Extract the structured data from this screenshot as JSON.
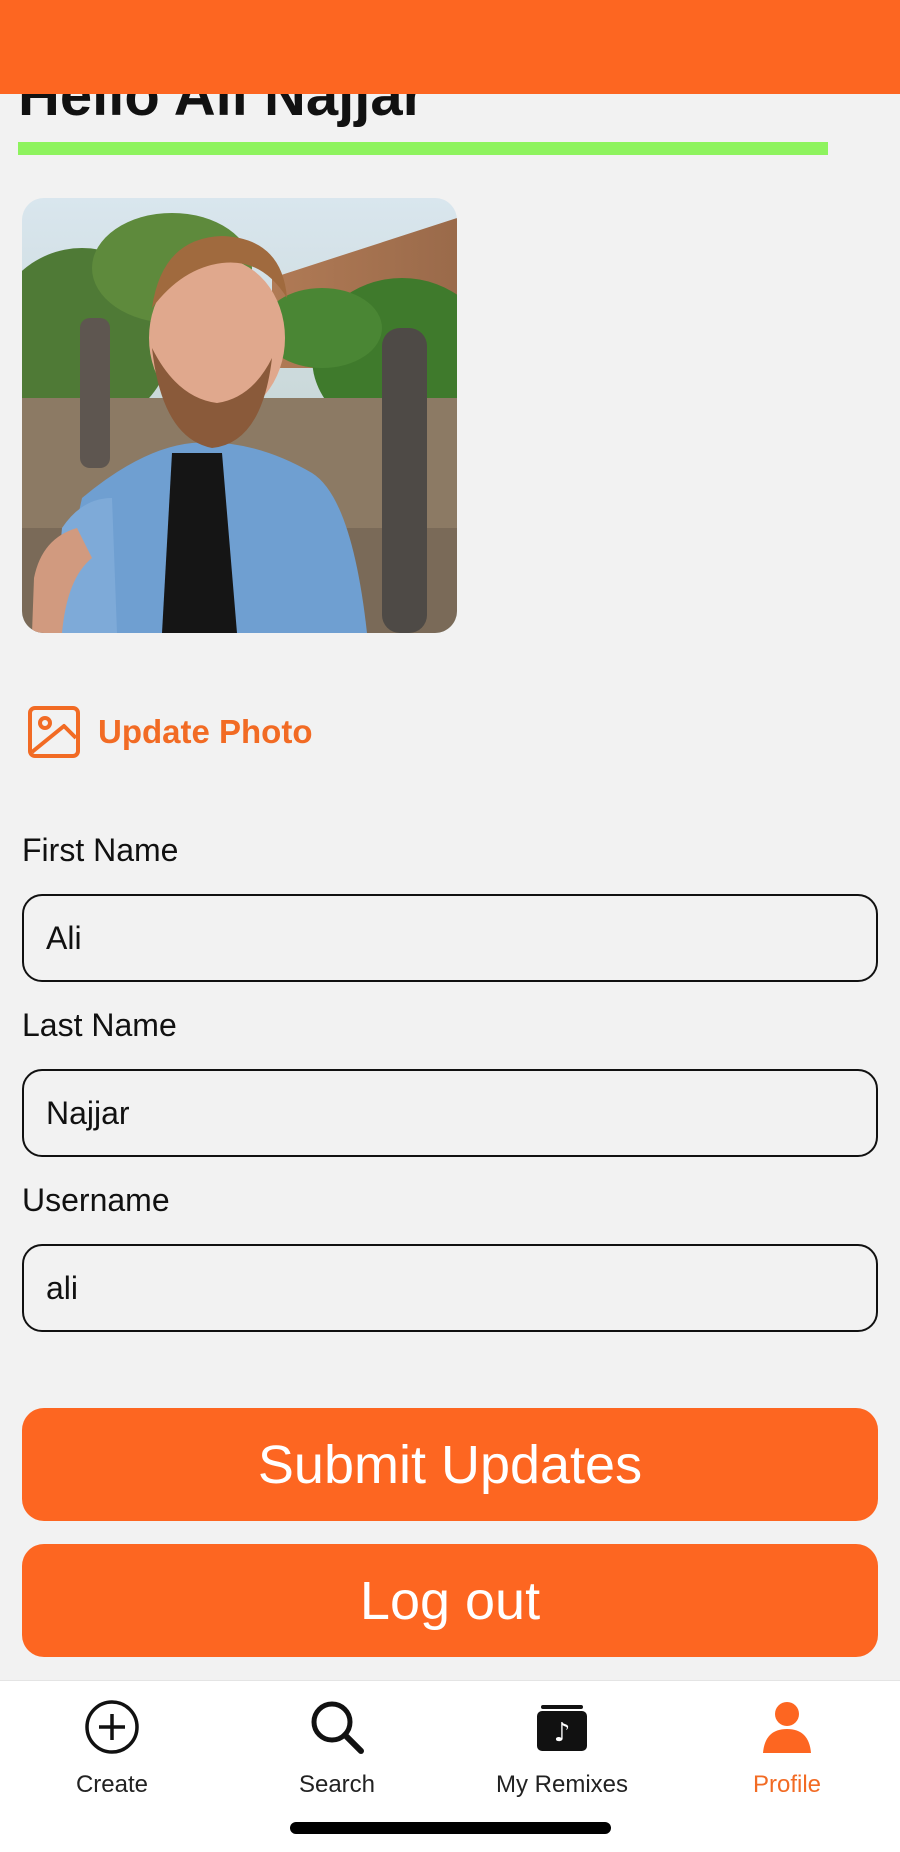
{
  "header": {
    "greeting": "Hello Ali Najjar",
    "progress": 1.0
  },
  "photo": {
    "alt": "Profile photo"
  },
  "update_photo": {
    "label": "Update Photo",
    "icon": "image-icon"
  },
  "form": {
    "first_name": {
      "label": "First Name",
      "value": "Ali"
    },
    "last_name": {
      "label": "Last Name",
      "value": "Najjar"
    },
    "username": {
      "label": "Username",
      "value": "ali"
    }
  },
  "buttons": {
    "submit": "Submit Updates",
    "logout": "Log out"
  },
  "tabs": [
    {
      "label": "Create",
      "icon": "plus-circle-icon",
      "active": false
    },
    {
      "label": "Search",
      "icon": "search-icon",
      "active": false
    },
    {
      "label": "My Remixes",
      "icon": "music-box-icon",
      "active": false
    },
    {
      "label": "Profile",
      "icon": "person-icon",
      "active": true
    }
  ],
  "colors": {
    "accent": "#fd6621",
    "progress": "#8ef35e",
    "background": "#f2f2f2"
  }
}
